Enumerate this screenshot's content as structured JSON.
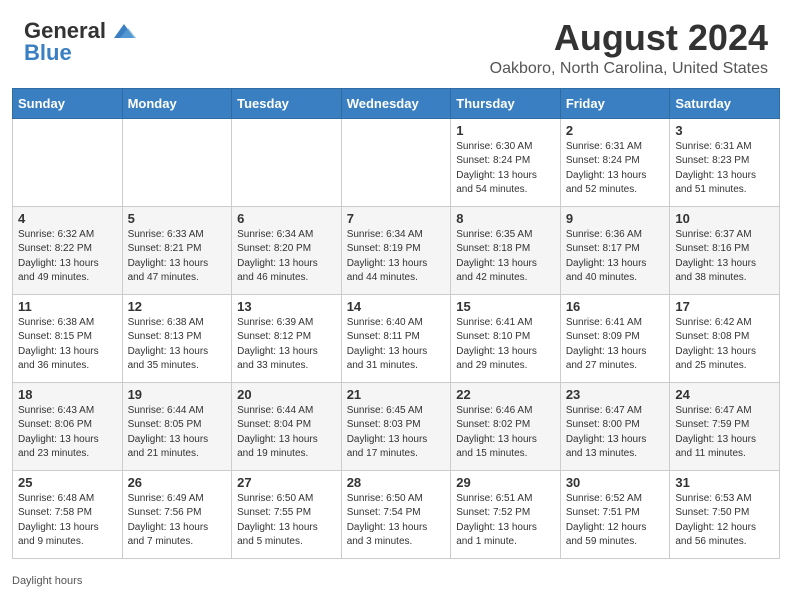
{
  "header": {
    "logo_general": "General",
    "logo_blue": "Blue",
    "month_year": "August 2024",
    "location": "Oakboro, North Carolina, United States"
  },
  "days_of_week": [
    "Sunday",
    "Monday",
    "Tuesday",
    "Wednesday",
    "Thursday",
    "Friday",
    "Saturday"
  ],
  "weeks": [
    [
      {
        "day": "",
        "info": ""
      },
      {
        "day": "",
        "info": ""
      },
      {
        "day": "",
        "info": ""
      },
      {
        "day": "",
        "info": ""
      },
      {
        "day": "1",
        "info": "Sunrise: 6:30 AM\nSunset: 8:24 PM\nDaylight: 13 hours\nand 54 minutes."
      },
      {
        "day": "2",
        "info": "Sunrise: 6:31 AM\nSunset: 8:24 PM\nDaylight: 13 hours\nand 52 minutes."
      },
      {
        "day": "3",
        "info": "Sunrise: 6:31 AM\nSunset: 8:23 PM\nDaylight: 13 hours\nand 51 minutes."
      }
    ],
    [
      {
        "day": "4",
        "info": "Sunrise: 6:32 AM\nSunset: 8:22 PM\nDaylight: 13 hours\nand 49 minutes."
      },
      {
        "day": "5",
        "info": "Sunrise: 6:33 AM\nSunset: 8:21 PM\nDaylight: 13 hours\nand 47 minutes."
      },
      {
        "day": "6",
        "info": "Sunrise: 6:34 AM\nSunset: 8:20 PM\nDaylight: 13 hours\nand 46 minutes."
      },
      {
        "day": "7",
        "info": "Sunrise: 6:34 AM\nSunset: 8:19 PM\nDaylight: 13 hours\nand 44 minutes."
      },
      {
        "day": "8",
        "info": "Sunrise: 6:35 AM\nSunset: 8:18 PM\nDaylight: 13 hours\nand 42 minutes."
      },
      {
        "day": "9",
        "info": "Sunrise: 6:36 AM\nSunset: 8:17 PM\nDaylight: 13 hours\nand 40 minutes."
      },
      {
        "day": "10",
        "info": "Sunrise: 6:37 AM\nSunset: 8:16 PM\nDaylight: 13 hours\nand 38 minutes."
      }
    ],
    [
      {
        "day": "11",
        "info": "Sunrise: 6:38 AM\nSunset: 8:15 PM\nDaylight: 13 hours\nand 36 minutes."
      },
      {
        "day": "12",
        "info": "Sunrise: 6:38 AM\nSunset: 8:13 PM\nDaylight: 13 hours\nand 35 minutes."
      },
      {
        "day": "13",
        "info": "Sunrise: 6:39 AM\nSunset: 8:12 PM\nDaylight: 13 hours\nand 33 minutes."
      },
      {
        "day": "14",
        "info": "Sunrise: 6:40 AM\nSunset: 8:11 PM\nDaylight: 13 hours\nand 31 minutes."
      },
      {
        "day": "15",
        "info": "Sunrise: 6:41 AM\nSunset: 8:10 PM\nDaylight: 13 hours\nand 29 minutes."
      },
      {
        "day": "16",
        "info": "Sunrise: 6:41 AM\nSunset: 8:09 PM\nDaylight: 13 hours\nand 27 minutes."
      },
      {
        "day": "17",
        "info": "Sunrise: 6:42 AM\nSunset: 8:08 PM\nDaylight: 13 hours\nand 25 minutes."
      }
    ],
    [
      {
        "day": "18",
        "info": "Sunrise: 6:43 AM\nSunset: 8:06 PM\nDaylight: 13 hours\nand 23 minutes."
      },
      {
        "day": "19",
        "info": "Sunrise: 6:44 AM\nSunset: 8:05 PM\nDaylight: 13 hours\nand 21 minutes."
      },
      {
        "day": "20",
        "info": "Sunrise: 6:44 AM\nSunset: 8:04 PM\nDaylight: 13 hours\nand 19 minutes."
      },
      {
        "day": "21",
        "info": "Sunrise: 6:45 AM\nSunset: 8:03 PM\nDaylight: 13 hours\nand 17 minutes."
      },
      {
        "day": "22",
        "info": "Sunrise: 6:46 AM\nSunset: 8:02 PM\nDaylight: 13 hours\nand 15 minutes."
      },
      {
        "day": "23",
        "info": "Sunrise: 6:47 AM\nSunset: 8:00 PM\nDaylight: 13 hours\nand 13 minutes."
      },
      {
        "day": "24",
        "info": "Sunrise: 6:47 AM\nSunset: 7:59 PM\nDaylight: 13 hours\nand 11 minutes."
      }
    ],
    [
      {
        "day": "25",
        "info": "Sunrise: 6:48 AM\nSunset: 7:58 PM\nDaylight: 13 hours\nand 9 minutes."
      },
      {
        "day": "26",
        "info": "Sunrise: 6:49 AM\nSunset: 7:56 PM\nDaylight: 13 hours\nand 7 minutes."
      },
      {
        "day": "27",
        "info": "Sunrise: 6:50 AM\nSunset: 7:55 PM\nDaylight: 13 hours\nand 5 minutes."
      },
      {
        "day": "28",
        "info": "Sunrise: 6:50 AM\nSunset: 7:54 PM\nDaylight: 13 hours\nand 3 minutes."
      },
      {
        "day": "29",
        "info": "Sunrise: 6:51 AM\nSunset: 7:52 PM\nDaylight: 13 hours\nand 1 minute."
      },
      {
        "day": "30",
        "info": "Sunrise: 6:52 AM\nSunset: 7:51 PM\nDaylight: 12 hours\nand 59 minutes."
      },
      {
        "day": "31",
        "info": "Sunrise: 6:53 AM\nSunset: 7:50 PM\nDaylight: 12 hours\nand 56 minutes."
      }
    ]
  ],
  "legend": "Daylight hours"
}
